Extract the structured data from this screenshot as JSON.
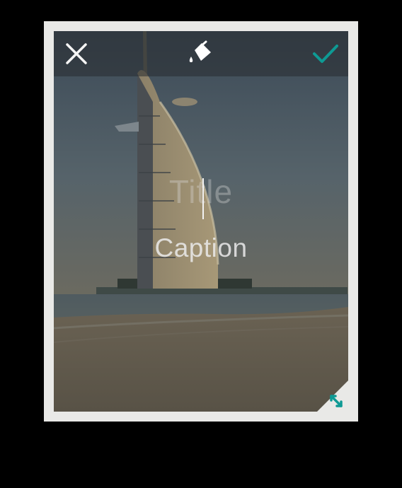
{
  "editor": {
    "title_placeholder": "Title",
    "caption_text": "Caption"
  },
  "toolbar": {
    "close_icon": "close-icon",
    "fill_icon": "paint-bucket-icon",
    "confirm_icon": "checkmark-icon"
  },
  "colors": {
    "accent": "#0e9a94",
    "card_frame": "#e9e9e7",
    "toolbar_overlay": "#282c30"
  }
}
